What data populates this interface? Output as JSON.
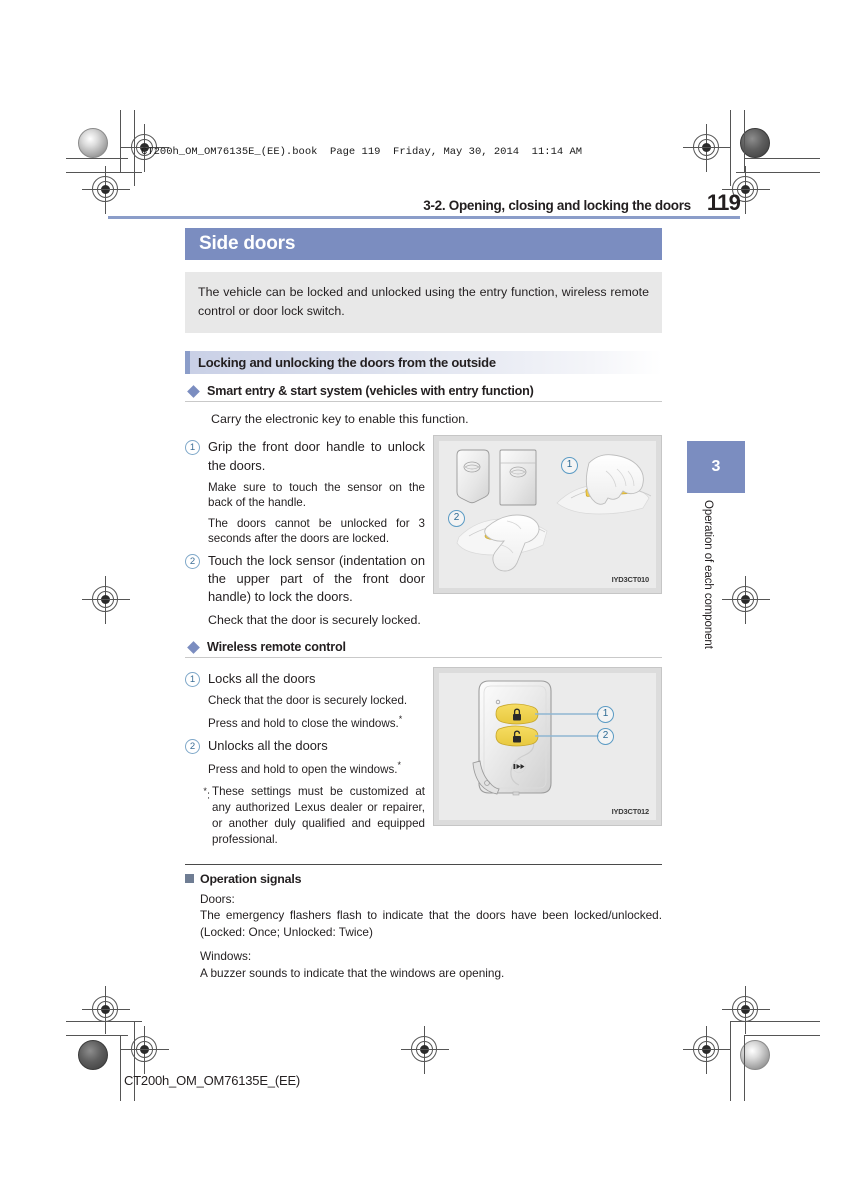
{
  "print_header": "CT200h_OM_OM76135E_(EE).book  Page 119  Friday, May 30, 2014  11:14 AM",
  "running_head": {
    "chapter_title": "3-2. Opening, closing and locking the doors",
    "page_number": "119"
  },
  "side_tab": {
    "number": "3",
    "label": "Operation of each component",
    "color": "#7b8dc0"
  },
  "title_band": {
    "text": "Side doors",
    "bg": "#7b8dc0",
    "fg": "#ffffff"
  },
  "intro": "The vehicle can be locked and unlocked using the entry function, wireless remote control or door lock switch.",
  "section": {
    "heading": "Locking and unlocking the doors from the outside"
  },
  "smart_entry": {
    "heading": "Smart entry & start system (vehicles with entry function)",
    "lead": "Carry the electronic key to enable this function.",
    "items": [
      {
        "num": "1",
        "text": "Grip the front door handle to unlock the doors.",
        "notes": [
          "Make sure to touch the sensor on the back of the handle.",
          "The doors cannot be unlocked for 3 seconds after the doors are locked."
        ]
      },
      {
        "num": "2",
        "text": "Touch the lock sensor (indentation on the upper part of the front door handle) to lock the doors.",
        "notes": [
          "Check that the door is securely locked."
        ]
      }
    ],
    "figure": {
      "code": "IYD3CT010",
      "callouts": [
        "1",
        "2"
      ]
    }
  },
  "wireless_remote": {
    "heading": "Wireless remote control",
    "items": [
      {
        "num": "1",
        "text": "Locks all the doors",
        "notes": [
          "Check that the door is securely locked.",
          "Press and hold to close the windows."
        ]
      },
      {
        "num": "2",
        "text": "Unlocks all the doors",
        "notes": [
          "Press and hold to open the windows."
        ]
      }
    ],
    "footnote_marker": "*",
    "footnote": "These settings must be customized at any authorized Lexus dealer or repairer, or another duly qualified and equipped professional.",
    "figure": {
      "code": "IYD3CT012",
      "callouts": [
        "1",
        "2"
      ],
      "button_icons": [
        "lock-closed-icon",
        "lock-open-icon",
        "trunk-release-icon"
      ]
    }
  },
  "operation_signals": {
    "heading": "Operation signals",
    "blocks": [
      {
        "label": "Doors:",
        "text": "The emergency flashers flash to indicate that the doors have been locked/unlocked. (Locked: Once; Unlocked: Twice)"
      },
      {
        "label": "Windows:",
        "text": "A buzzer sounds to indicate that the windows are opening."
      }
    ]
  },
  "footer": "CT200h_OM_OM76135E_(EE)"
}
